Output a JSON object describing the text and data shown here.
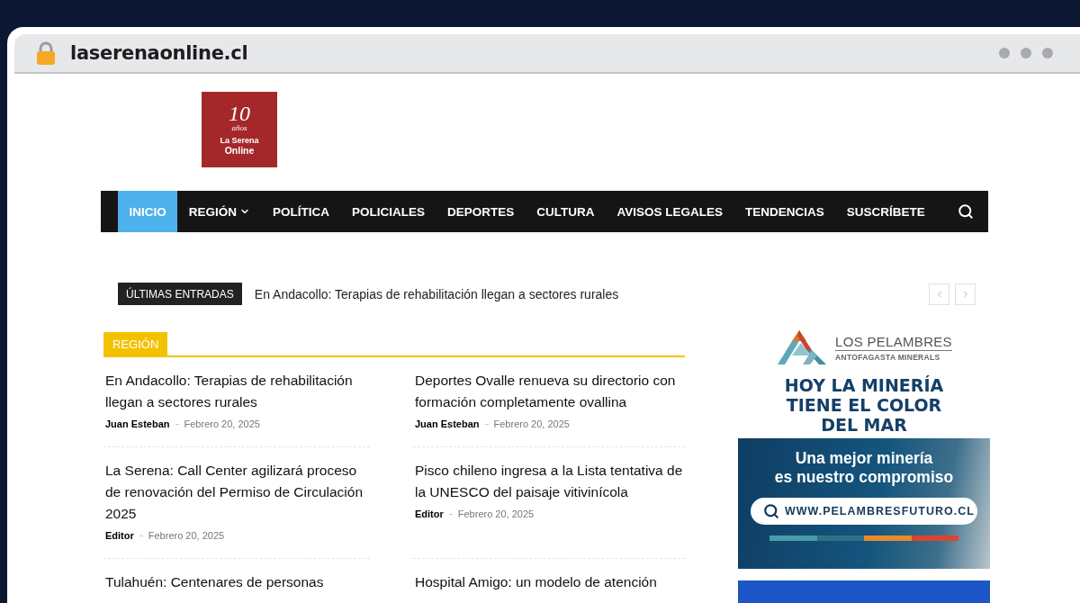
{
  "browser": {
    "url": "laserenaonline.cl"
  },
  "logo": {
    "number": "10",
    "script": "años",
    "line_1": "La Serena",
    "line_2": "Online"
  },
  "nav": {
    "items": [
      {
        "label": "INICIO",
        "selected": true,
        "dropdown": false
      },
      {
        "label": "REGIÓN",
        "selected": false,
        "dropdown": true
      },
      {
        "label": "POLÍTICA",
        "selected": false,
        "dropdown": false
      },
      {
        "label": "POLICIALES",
        "selected": false,
        "dropdown": false
      },
      {
        "label": "DEPORTES",
        "selected": false,
        "dropdown": false
      },
      {
        "label": "CULTURA",
        "selected": false,
        "dropdown": false
      },
      {
        "label": "AVISOS LEGALES",
        "selected": false,
        "dropdown": false
      },
      {
        "label": "TENDENCIAS",
        "selected": false,
        "dropdown": false
      },
      {
        "label": "SUSCRÍBETE",
        "selected": false,
        "dropdown": false
      }
    ]
  },
  "ticker": {
    "label": "ÚLTIMAS ENTRADAS",
    "headline": "En Andacollo: Terapias de rehabilitación llegan a sectores rurales"
  },
  "block": {
    "title": "REGIÓN",
    "articles": [
      {
        "title": "En Andacollo: Terapias de rehabilitación llegan a sectores rurales",
        "author": "Juan Esteban",
        "date": "Febrero 20, 2025"
      },
      {
        "title": "Deportes Ovalle renueva su directorio con formación completamente ovallina",
        "author": "Juan Esteban",
        "date": "Febrero 20, 2025"
      },
      {
        "title": "La Serena: Call Center agilizará proceso de renovación del Permiso de Circulación 2025",
        "author": "Editor",
        "date": "Febrero 20, 2025"
      },
      {
        "title": "Pisco chileno ingresa a la Lista tentativa de la UNESCO del paisaje vitivinícola",
        "author": "Editor",
        "date": "Febrero 20, 2025"
      },
      {
        "title": "Tulahuén: Centenares de personas"
      },
      {
        "title": "Hospital Amigo: un modelo de atención"
      }
    ]
  },
  "ad": {
    "brand": "LOS PELAMBRES",
    "brand_subtitle": "ANTOFAGASTA MINERALS",
    "headline_lines": [
      "HOY LA MINERÍA",
      "TIENE EL COLOR",
      "DEL MAR"
    ],
    "tagline_lines": [
      "Una mejor minería",
      "es nuestro compromiso"
    ],
    "url": "WWW.PELAMBRESFUTURO.CL"
  }
}
